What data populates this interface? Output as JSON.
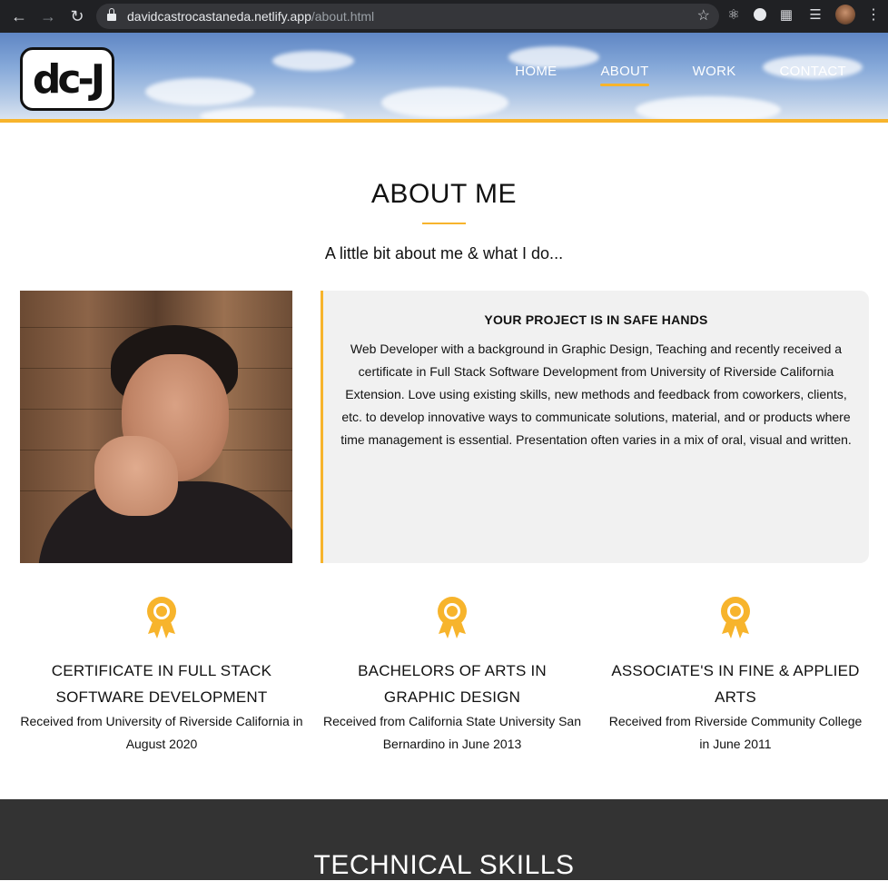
{
  "browser": {
    "url_host": "davidcastrocastaneda.netlify.app",
    "url_path": "/about.html"
  },
  "site": {
    "logo_text": "dc-J",
    "nav": [
      {
        "label": "HOME"
      },
      {
        "label": "ABOUT"
      },
      {
        "label": "WORK"
      },
      {
        "label": "CONTACT"
      }
    ],
    "active_nav": "ABOUT"
  },
  "about": {
    "title": "ABOUT ME",
    "subtitle": "A little bit about me & what I do...",
    "box_heading": "YOUR PROJECT IS IN SAFE HANDS",
    "box_text": "Web Developer with a background in Graphic Design, Teaching and recently received a certificate in Full Stack Software Development from University of Riverside California Extension. Love using existing skills, new methods and feedback from coworkers, clients, etc. to develop innovative ways to communicate solutions, material, and or products where time management is essential. Presentation often varies in a mix of oral, visual and written."
  },
  "credentials": [
    {
      "title": "CERTIFICATE IN FULL STACK SOFTWARE DEVELOPMENT",
      "desc": "Received from University of Riverside California in August 2020"
    },
    {
      "title": "BACHELORS OF ARTS IN GRAPHIC DESIGN",
      "desc": "Received from California State University San Bernardino in June 2013"
    },
    {
      "title": "ASSOCIATE'S IN FINE & APPLIED ARTS",
      "desc": "Received from Riverside Community College in June 2011"
    }
  ],
  "skills": {
    "title": "TECHNICAL SKILLS"
  },
  "colors": {
    "accent": "#f7b42c",
    "dark_section": "#333333",
    "info_box": "#f1f1f1"
  }
}
